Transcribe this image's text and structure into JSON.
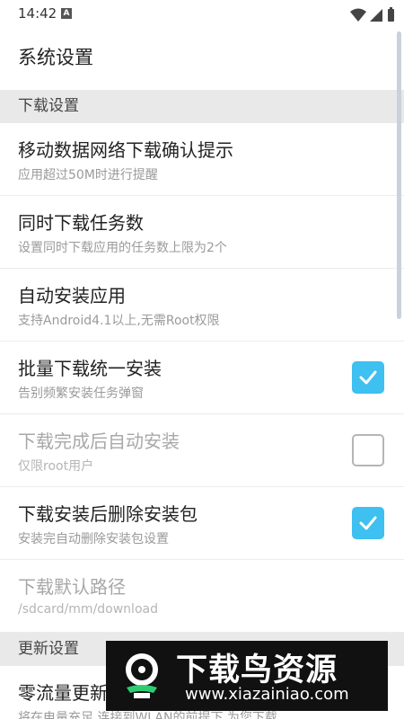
{
  "status_bar": {
    "time": "14:42",
    "notification_letter": "A"
  },
  "title": "系统设置",
  "sections": [
    {
      "header": "下载设置",
      "items": [
        {
          "title": "移动数据网络下载确认提示",
          "subtitle": "应用超过50M时进行提醒"
        },
        {
          "title": "同时下载任务数",
          "subtitle": "设置同时下载应用的任务数上限为2个"
        },
        {
          "title": "自动安装应用",
          "subtitle": "支持Android4.1以上,无需Root权限"
        },
        {
          "title": "批量下载统一安装",
          "subtitle": "告别频繁安装任务弹窗",
          "checkbox": "checked"
        },
        {
          "title": "下载完成后自动安装",
          "subtitle": "仅限root用户",
          "checkbox": "unchecked",
          "disabled": true
        },
        {
          "title": "下载安装后删除安装包",
          "subtitle": "安装完自动删除安装包设置",
          "checkbox": "checked"
        },
        {
          "title": "下载默认路径",
          "subtitle": "/sdcard/mm/download",
          "disabled": true
        }
      ]
    },
    {
      "header": "更新设置",
      "items": [
        {
          "title": "零流量更新",
          "subtitle": "将在电量充足,连接到WLAN的前提下,为您下载"
        }
      ]
    }
  ],
  "watermark": {
    "title": "下载鸟资源",
    "url": "www.xiazainiao.com"
  },
  "colors": {
    "accent": "#3ec0f0",
    "section_bg": "#e9e9e9",
    "watermark_bg": "#111111"
  },
  "icons": {
    "wifi": "wifi-icon",
    "signal": "signal-icon",
    "battery": "battery-icon",
    "check": "check-icon"
  }
}
